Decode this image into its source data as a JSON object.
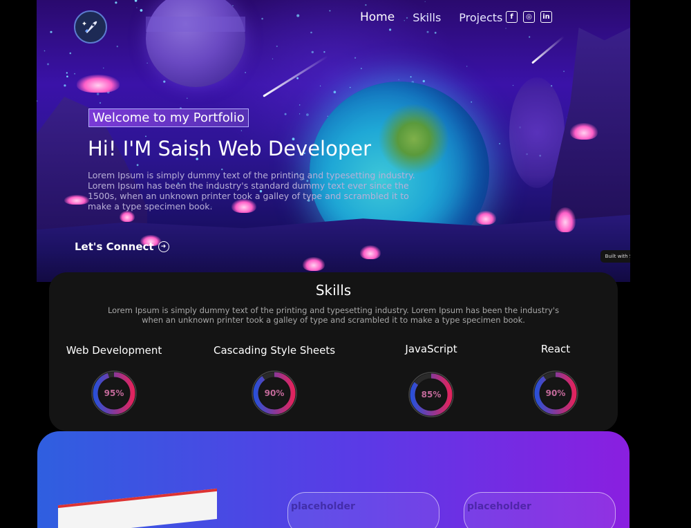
{
  "nav": {
    "links": [
      "Home",
      "Skills",
      "Projects"
    ],
    "socials": [
      {
        "icon": "facebook-icon",
        "glyph": "f"
      },
      {
        "icon": "instagram-icon",
        "glyph": "◎"
      },
      {
        "icon": "linkedin-icon",
        "glyph": "in"
      }
    ]
  },
  "hero": {
    "tagline": "Welcome to my Portfolio",
    "title": "Hi! I'M Saish Web Developer",
    "description": "Lorem Ipsum is simply dummy text of the printing and typesetting industry. Lorem Ipsum has been the industry's standard dummy text ever since the 1500s, when an unknown printer took a galley of type and scrambled it to make a type specimen book.",
    "cta": "Let's Connect",
    "badge": "Built with Spline"
  },
  "skills": {
    "title": "Skills",
    "description": "Lorem Ipsum is simply dummy text of the printing and typesetting industry. Lorem Ipsum has been the industry's when an unknown printer took a galley of type and scrambled it to make a type specimen book.",
    "items": [
      {
        "name": "Web Development",
        "percent": 95,
        "label": "95%"
      },
      {
        "name": "Cascading Style Sheets",
        "percent": 90,
        "label": "90%"
      },
      {
        "name": "JavaScript",
        "percent": 85,
        "label": "85%"
      },
      {
        "name": "React",
        "percent": 90,
        "label": "90%"
      }
    ]
  },
  "projects": {
    "cards": [
      "placeholder",
      "placeholder"
    ]
  },
  "colors": {
    "ring_start": "#2b4fd6",
    "ring_end": "#e0245e",
    "accent": "#7a3ad6"
  }
}
